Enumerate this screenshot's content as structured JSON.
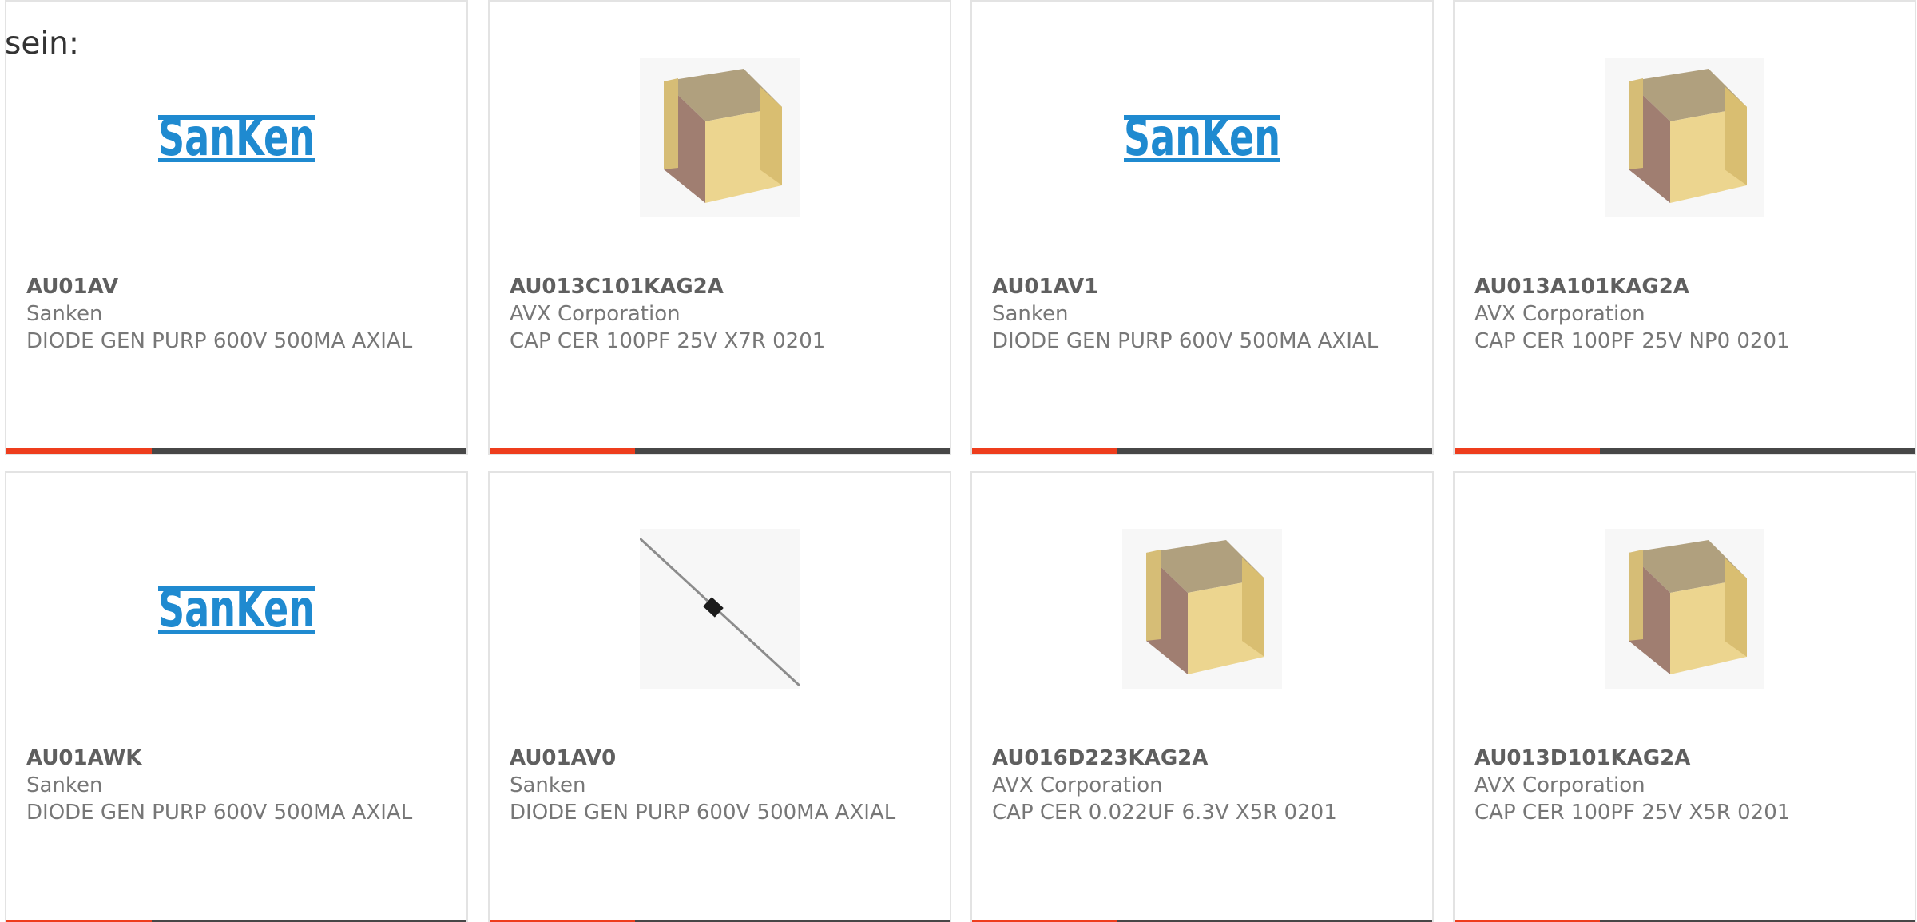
{
  "intro_text": "sein:",
  "accent_color": "#ee3d1d",
  "bar_color": "#474747",
  "products": [
    {
      "part": "AU01AV",
      "manufacturer": "Sanken",
      "description": "DIODE GEN PURP 600V 500MA AXIAL",
      "image": "sanken-logo"
    },
    {
      "part": "AU013C101KAG2A",
      "manufacturer": "AVX Corporation",
      "description": "CAP CER 100PF 25V X7R 0201",
      "image": "ceramic-chip-capacitor"
    },
    {
      "part": "AU01AV1",
      "manufacturer": "Sanken",
      "description": "DIODE GEN PURP 600V 500MA AXIAL",
      "image": "sanken-logo"
    },
    {
      "part": "AU013A101KAG2A",
      "manufacturer": "AVX Corporation",
      "description": "CAP CER 100PF 25V NP0 0201",
      "image": "ceramic-chip-capacitor"
    },
    {
      "part": "AU01AWK",
      "manufacturer": "Sanken",
      "description": "DIODE GEN PURP 600V 500MA AXIAL",
      "image": "sanken-logo"
    },
    {
      "part": "AU01AV0",
      "manufacturer": "Sanken",
      "description": "DIODE GEN PURP 600V 500MA AXIAL",
      "image": "axial-diode"
    },
    {
      "part": "AU016D223KAG2A",
      "manufacturer": "AVX Corporation",
      "description": "CAP CER 0.022UF 6.3V X5R 0201",
      "image": "ceramic-chip-capacitor"
    },
    {
      "part": "AU013D101KAG2A",
      "manufacturer": "AVX Corporation",
      "description": "CAP CER 100PF 25V X5R 0201",
      "image": "ceramic-chip-capacitor"
    }
  ]
}
